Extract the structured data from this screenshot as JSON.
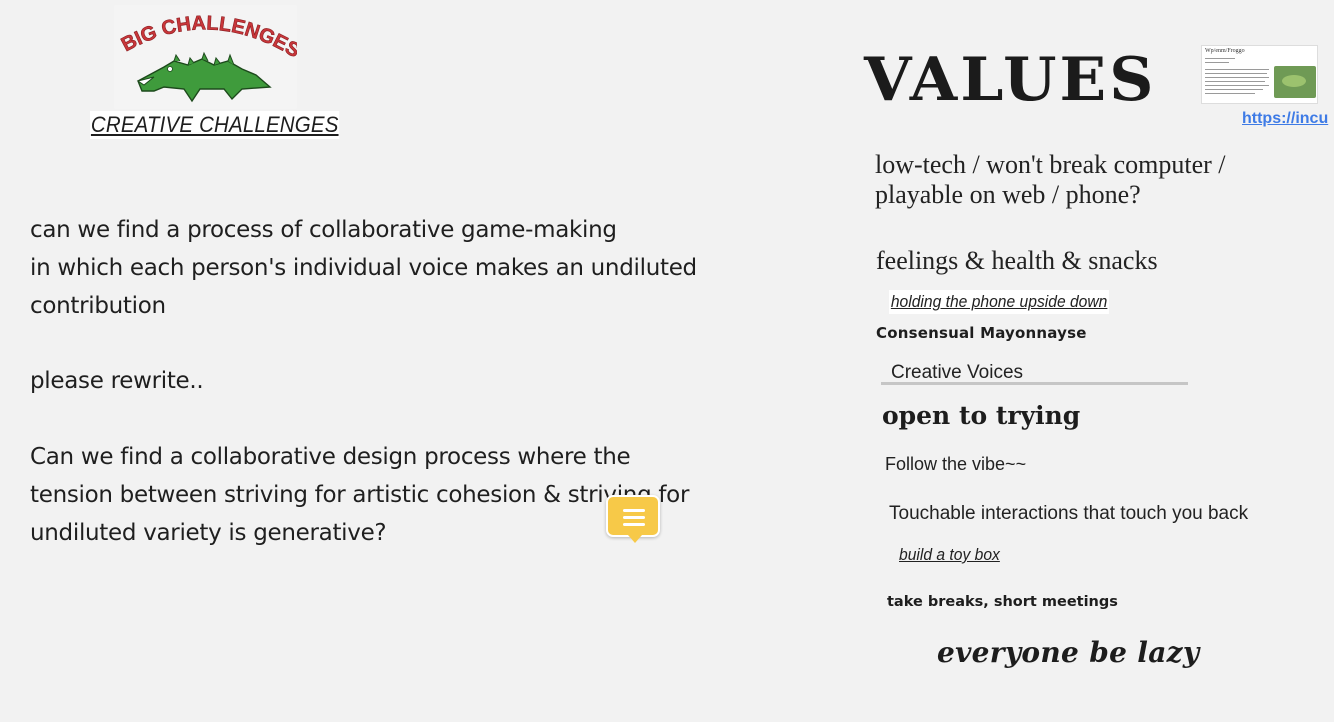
{
  "header": {
    "logo_text": "BIG CHALLENGES",
    "link_label": "CREATIVE CHALLENGES"
  },
  "main": {
    "paragraph_1": "can we find a process of collaborative game-making\nin which each person's individual voice makes an undiluted\ncontribution",
    "paragraph_2": "please rewrite..",
    "paragraph_3": "Can we find a collaborative design process where the\ntension between striving for artistic cohesion & striving for\nundiluted variety is generative?"
  },
  "values": {
    "title": "VALUES",
    "url_link": "https://incu",
    "thumbnail_title": "Wp/enm/Froggo",
    "items": [
      "low-tech / won't break computer /\nplayable on web / phone?",
      "feelings & health & snacks",
      "holding the phone upside down",
      "Consensual Mayonnayse",
      "Creative Voices",
      "open to trying",
      "Follow the vibe~~",
      "Touchable interactions that touch you back",
      "build a toy box",
      "take breaks, short meetings",
      "everyone be lazy"
    ]
  },
  "icons": {
    "comment": "comment-icon",
    "logo": "crocodile-logo"
  },
  "colors": {
    "background": "#f2f2f2",
    "comment_yellow": "#f7c948",
    "link_blue": "#3e7be6",
    "logo_red": "#c8363a",
    "logo_green": "#3f9b3c"
  }
}
